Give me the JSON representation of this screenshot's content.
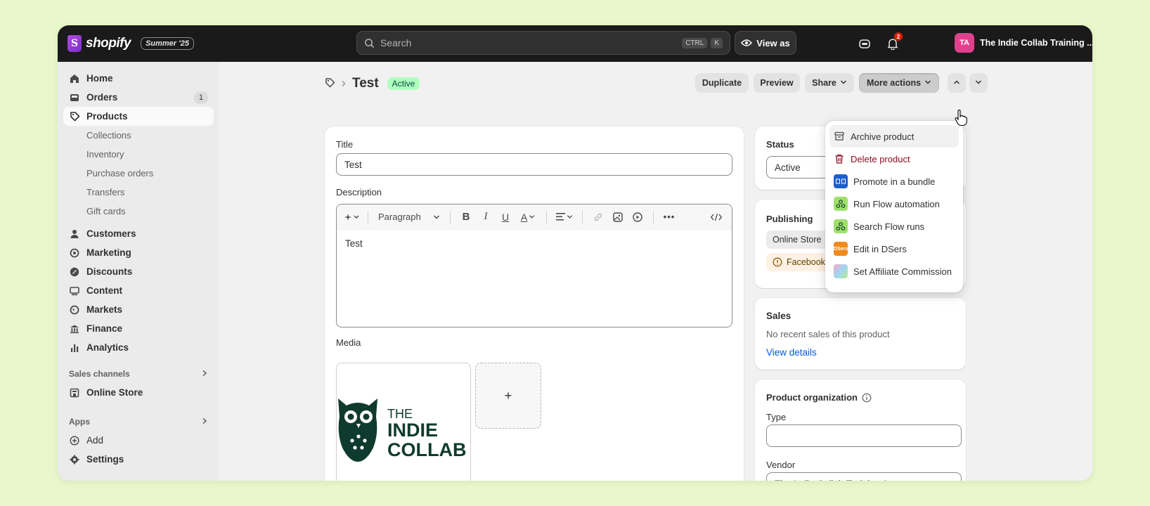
{
  "topbar": {
    "brand": "shopify",
    "edition": "Summer '25",
    "search_placeholder": "Search",
    "shortcut_ctrl": "CTRL",
    "shortcut_key": "K",
    "view_as": "View as",
    "notifications_count": "2",
    "avatar_initials": "TA",
    "store_name": "The Indie Collab Training ..."
  },
  "sidebar": {
    "items": [
      {
        "label": "Home",
        "icon": "home-icon"
      },
      {
        "label": "Orders",
        "icon": "inbox-icon",
        "badge": "1"
      },
      {
        "label": "Products",
        "icon": "tag-icon",
        "active": true
      }
    ],
    "product_subitems": [
      "Collections",
      "Inventory",
      "Purchase orders",
      "Transfers",
      "Gift cards"
    ],
    "items2": [
      {
        "label": "Customers",
        "icon": "person-icon"
      },
      {
        "label": "Marketing",
        "icon": "target-icon"
      },
      {
        "label": "Discounts",
        "icon": "discount-icon"
      },
      {
        "label": "Content",
        "icon": "content-icon"
      },
      {
        "label": "Markets",
        "icon": "globe-icon"
      },
      {
        "label": "Finance",
        "icon": "bank-icon"
      },
      {
        "label": "Analytics",
        "icon": "bar-chart-icon"
      }
    ],
    "sales_channels_label": "Sales channels",
    "online_store": "Online Store",
    "apps_label": "Apps",
    "add": "Add",
    "settings": "Settings"
  },
  "page": {
    "title": "Test",
    "status_badge": "Active",
    "buttons": {
      "duplicate": "Duplicate",
      "preview": "Preview",
      "share": "Share",
      "more_actions": "More actions"
    }
  },
  "product_form": {
    "title_label": "Title",
    "title_value": "Test",
    "description_label": "Description",
    "paragraph_select": "Paragraph",
    "description_value": "Test",
    "media_label": "Media",
    "media_add": "+",
    "logo_text_1": "THE",
    "logo_text_2": "INDIE",
    "logo_text_3": "COLLAB"
  },
  "status_card": {
    "label": "Status",
    "value": "Active"
  },
  "publishing_card": {
    "label": "Publishing",
    "online_store": "Online Store",
    "facebook": "Facebook & In"
  },
  "sales_card": {
    "label": "Sales",
    "text": "No recent sales of this product",
    "link": "View details"
  },
  "organization_card": {
    "label": "Product organization",
    "type_label": "Type",
    "type_value": "",
    "vendor_label": "Vendor",
    "vendor_value": "The Indie Collab Training Account"
  },
  "more_actions_menu": [
    {
      "label": "Archive product",
      "icon": "archive-icon"
    },
    {
      "label": "Delete product",
      "icon": "trash-icon"
    },
    {
      "label": "Promote in a bundle",
      "icon": "bundle-app-icon"
    },
    {
      "label": "Run Flow automation",
      "icon": "flow-app-icon"
    },
    {
      "label": "Search Flow runs",
      "icon": "flow-app-icon"
    },
    {
      "label": "Edit in DSers",
      "icon": "dsers-app-icon",
      "icon_text": "DSers"
    },
    {
      "label": "Set Affiliate Commission",
      "icon": "affiliate-app-icon"
    }
  ],
  "colors": {
    "background": "#e8f8cb",
    "topbar": "#1a1a1a",
    "active_badge": "#affebf",
    "avatar": "#e0418d",
    "link": "#005bd3",
    "danger": "#8e0b21",
    "owl_green": "#0f3b2e"
  }
}
